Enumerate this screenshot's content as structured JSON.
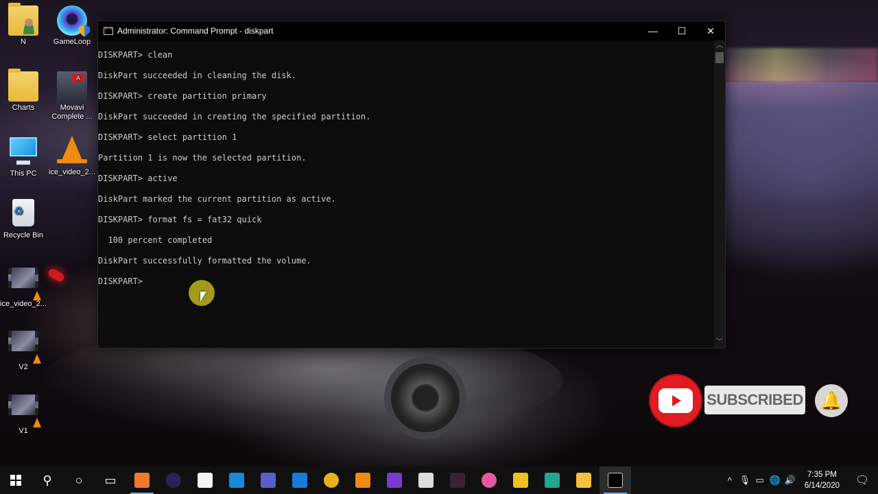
{
  "desktop": {
    "icons": [
      {
        "label": "N",
        "icon": "user-folder-icon"
      },
      {
        "label": "GameLoop",
        "icon": "gameloop-icon"
      },
      {
        "label": "Charts",
        "icon": "folder-icon"
      },
      {
        "label": "Movavi Complete ...",
        "icon": "movavi-video-icon"
      },
      {
        "label": "This PC",
        "icon": "this-pc-icon"
      },
      {
        "label": "ice_video_2...",
        "icon": "vlc-icon"
      },
      {
        "label": "Recycle Bin",
        "icon": "recycle-bin-icon"
      },
      {
        "label": "ice_video_2...",
        "icon": "video-file-icon"
      },
      {
        "label": "V2",
        "icon": "video-file-icon"
      },
      {
        "label": "V1",
        "icon": "video-file-icon"
      }
    ]
  },
  "cmd": {
    "title": "Administrator: Command Prompt - diskpart",
    "minimize": "—",
    "maximize": "☐",
    "close": "✕",
    "lines": [
      "DISKPART> clean",
      "",
      "DiskPart succeeded in cleaning the disk.",
      "",
      "DISKPART> create partition primary",
      "",
      "DiskPart succeeded in creating the specified partition.",
      "",
      "DISKPART> select partition 1",
      "",
      "Partition 1 is now the selected partition.",
      "",
      "DISKPART> active",
      "",
      "DiskPart marked the current partition as active.",
      "",
      "DISKPART> format fs = fat32 quick",
      "",
      "  100 percent completed",
      "",
      "DiskPart successfully formatted the volume.",
      "",
      "DISKPART> "
    ]
  },
  "overlay": {
    "subscribed_label": "SUBSCRIBED",
    "bell": "🔔"
  },
  "taskbar": {
    "start": "start-icon",
    "apps": [
      {
        "name": "search",
        "glyph": "⚲"
      },
      {
        "name": "cortana",
        "glyph": "○"
      },
      {
        "name": "task-view",
        "glyph": "▭"
      },
      {
        "name": "screen-recorder",
        "color": "#f07a2a"
      },
      {
        "name": "eclipse",
        "color": "#2c2255"
      },
      {
        "name": "microsoft-store",
        "color": "#f4f4f4"
      },
      {
        "name": "mail",
        "color": "#1a8ad8"
      },
      {
        "name": "teams",
        "color": "#5a5fc8"
      },
      {
        "name": "edge",
        "color": "#1a7ad8"
      },
      {
        "name": "chrome",
        "color": "#e8b020"
      },
      {
        "name": "vlc",
        "color": "#f08a10"
      },
      {
        "name": "visual-studio",
        "color": "#7a3ad0"
      },
      {
        "name": "video-editor",
        "color": "#dcdcdc"
      },
      {
        "name": "filmora",
        "color": "#3a2230"
      },
      {
        "name": "pinwheel-app",
        "color": "#e85aa0"
      },
      {
        "name": "backpack-app",
        "color": "#f0c020"
      },
      {
        "name": "filmora-green",
        "color": "#1fa890"
      },
      {
        "name": "file-explorer",
        "color": "#f4c040"
      },
      {
        "name": "command-prompt",
        "color": "#000000"
      }
    ],
    "tray": {
      "chevron": "^",
      "mic": "🎙",
      "battery": "▭",
      "network": "🌐",
      "volume": "🔊",
      "time": "7:35 PM",
      "date": "6/14/2020",
      "notifications": "🗨"
    }
  }
}
